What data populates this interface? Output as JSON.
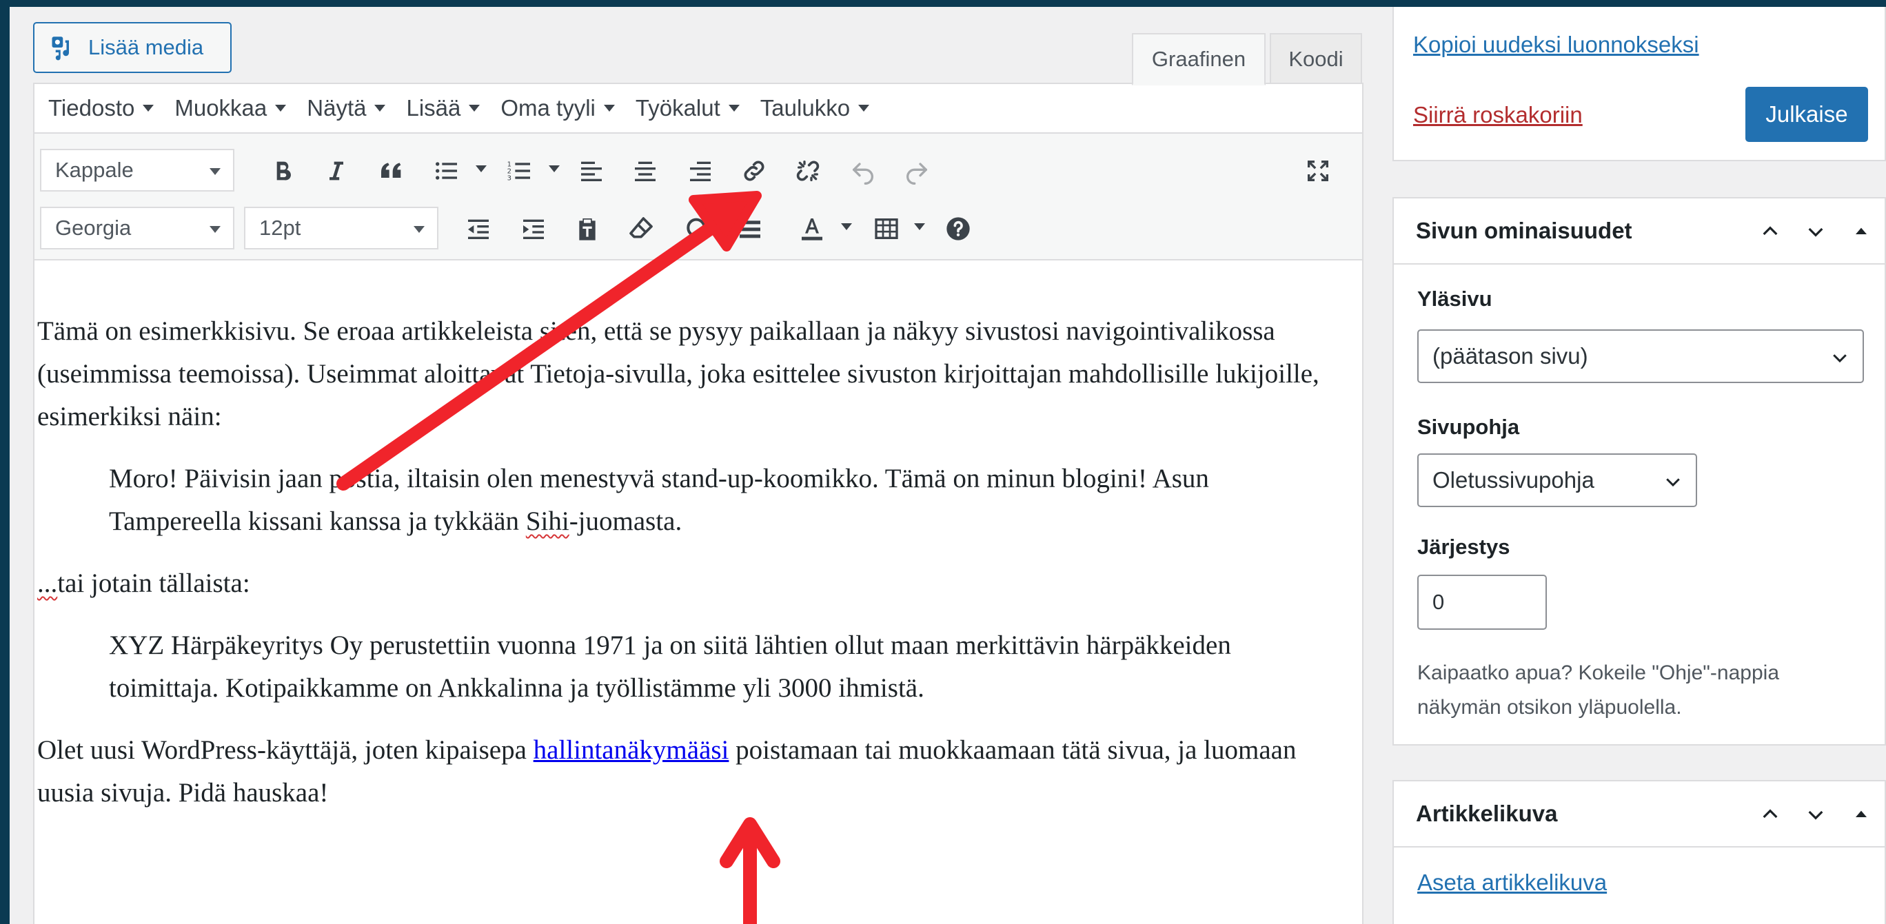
{
  "editor": {
    "add_media_label": "Lisää media",
    "tabs": {
      "visual": "Graafinen",
      "code": "Koodi"
    },
    "menubar": [
      {
        "label": "Tiedosto"
      },
      {
        "label": "Muokkaa"
      },
      {
        "label": "Näytä"
      },
      {
        "label": "Lisää"
      },
      {
        "label": "Oma tyyli"
      },
      {
        "label": "Työkalut"
      },
      {
        "label": "Taulukko"
      }
    ],
    "format_select": "Kappale",
    "font_select": "Georgia",
    "size_select": "12pt",
    "toolbar_row1_icons": [
      "bold-icon",
      "italic-icon",
      "blockquote-icon",
      "bullet-list-icon",
      "numbered-list-icon",
      "align-left-icon",
      "align-center-icon",
      "align-right-icon",
      "link-icon",
      "unlink-icon",
      "undo-icon",
      "redo-icon",
      "fullscreen-icon"
    ],
    "toolbar_row2_icons": [
      "outdent-icon",
      "indent-icon",
      "paste-text-icon",
      "clear-formatting-icon",
      "special-char-icon",
      "hr-icon",
      "text-color-icon",
      "table-icon",
      "help-icon"
    ]
  },
  "content": {
    "p1": "Tämä on esimerkkisivu. Se eroaa artikkeleista siten, että se pysyy paikallaan ja näkyy sivustosi navigointivalikossa (useimmissa teemoissa). Useimmat aloittavat Tietoja-sivulla, joka esittelee sivuston kirjoittajan mahdollisille lukijoille, esimerkiksi näin:",
    "quote1_before": "Moro! Päivisin jaan postia, iltaisin olen menestyvä stand-up-koomikko. Tämä on minun blogini! Asun Tampereella kissani kanssa ja tykkään ",
    "quote1_word": "Sihi",
    "quote1_after": "-juomasta.",
    "p2_dots": "...",
    "p2_rest": "tai jotain tällaista:",
    "quote2": "XYZ Härpäkeyritys Oy perustettiin vuonna 1971 ja on siitä lähtien ollut maan merkittävin härpäkkeiden toimittaja. Kotipaikkamme on Ankkalinna ja työllistämme yli 3000 ihmistä.",
    "p3_before": "Olet uusi WordPress-käyttäjä, joten kipaisepa ",
    "p3_link": "hallintanäkymääsi",
    "p3_after": " poistamaan tai muokkaamaan tätä sivua, ja luomaan uusia sivuja. Pidä hauskaa!"
  },
  "sidebar": {
    "copy_draft": "Kopioi uudeksi luonnokseksi",
    "trash": "Siirrä roskakoriin",
    "publish": "Julkaise",
    "attributes": {
      "title": "Sivun ominaisuudet",
      "parent_label": "Yläsivu",
      "parent_value": "(päätason sivu)",
      "template_label": "Sivupohja",
      "template_value": "Oletussivupohja",
      "order_label": "Järjestys",
      "order_value": "0",
      "help": "Kaipaatko apua? Kokeile \"Ohje\"-nappia näkymän otsikon yläpuolella."
    },
    "featured_image": {
      "title": "Artikkelikuva",
      "set_link": "Aseta artikkelikuva"
    }
  },
  "colors": {
    "frame": "#0b3a52",
    "accent": "#2271b1",
    "danger": "#b32d2e",
    "annotation_arrow": "#f0242b"
  }
}
